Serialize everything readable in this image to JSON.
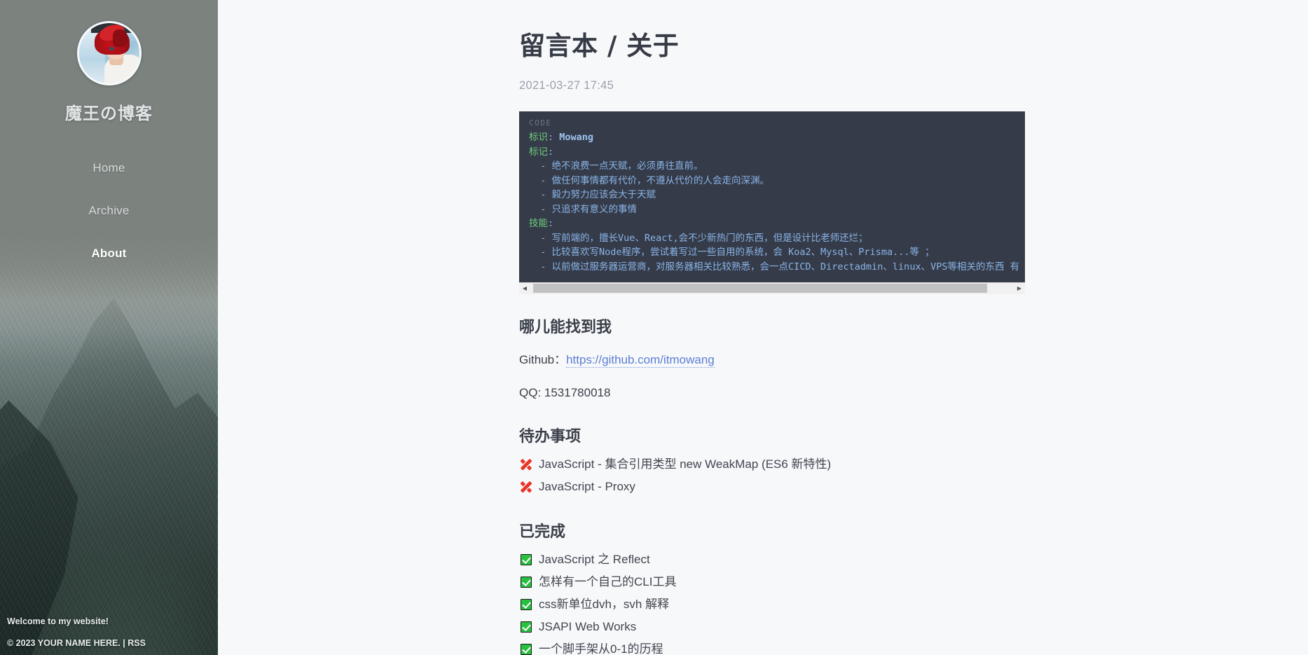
{
  "sidebar": {
    "avatar_alt": "avatar",
    "site_title": "魔王の博客",
    "nav": [
      {
        "label": "Home",
        "active": false
      },
      {
        "label": "Archive",
        "active": false
      },
      {
        "label": "About",
        "active": true
      }
    ],
    "welcome_text": "Welcome to my website!",
    "copyright": "© 2023 YOUR NAME HERE. | ",
    "rss_label": "RSS"
  },
  "post": {
    "title": "留言本 / 关于",
    "date": "2021-03-27 17:45"
  },
  "code_block": {
    "label": "CODE",
    "ident_key": "标识",
    "ident_value": "Mowang",
    "marks_key": "标记",
    "marks": [
      "绝不浪费一点天赋，必须勇往直前。",
      "做任何事情都有代价，不遵从代价的人会走向深渊。",
      "毅力努力应该会大于天赋",
      "只追求有意义的事情"
    ],
    "skills_key": "技能",
    "skills": [
      "写前端的，擅长Vue、React,会不少新热门的东西，但是设计比老师还烂；",
      "比较喜欢写Node程序，尝试着写过一些自用的系统，会 Koa2、Mysql、Prisma...等 ；",
      "以前做过服务器运营商，对服务器相关比较熟悉，会一点CICD、Directadmin、linux、VPS等相关的东西 有"
    ]
  },
  "find_me": {
    "heading": "哪儿能找到我",
    "github_label": "Github：",
    "github_url": "https://github.com/itmowang",
    "qq": "QQ: 1531780018"
  },
  "todo": {
    "heading": "待办事项",
    "items": [
      "JavaScript - 集合引用类型 new WeakMap (ES6 新特性)",
      "JavaScript - Proxy"
    ]
  },
  "done": {
    "heading": "已完成",
    "items": [
      "JavaScript 之 Reflect",
      "怎样有一个自己的CLI工具",
      "css新单位dvh，svh 解释",
      "JSAPI Web Works",
      "一个脚手架从0-1的历程"
    ]
  },
  "scrollbar": {
    "left_arrow": "◀",
    "right_arrow": "▶"
  },
  "colors": {
    "page_bg": "#f7f8fa",
    "code_bg": "#353b48",
    "code_key": "#6fcf7f",
    "code_value": "#8ab4e8",
    "link": "#5b7fd4",
    "x_mark": "#e8362a",
    "check_mark": "#27c13f"
  }
}
